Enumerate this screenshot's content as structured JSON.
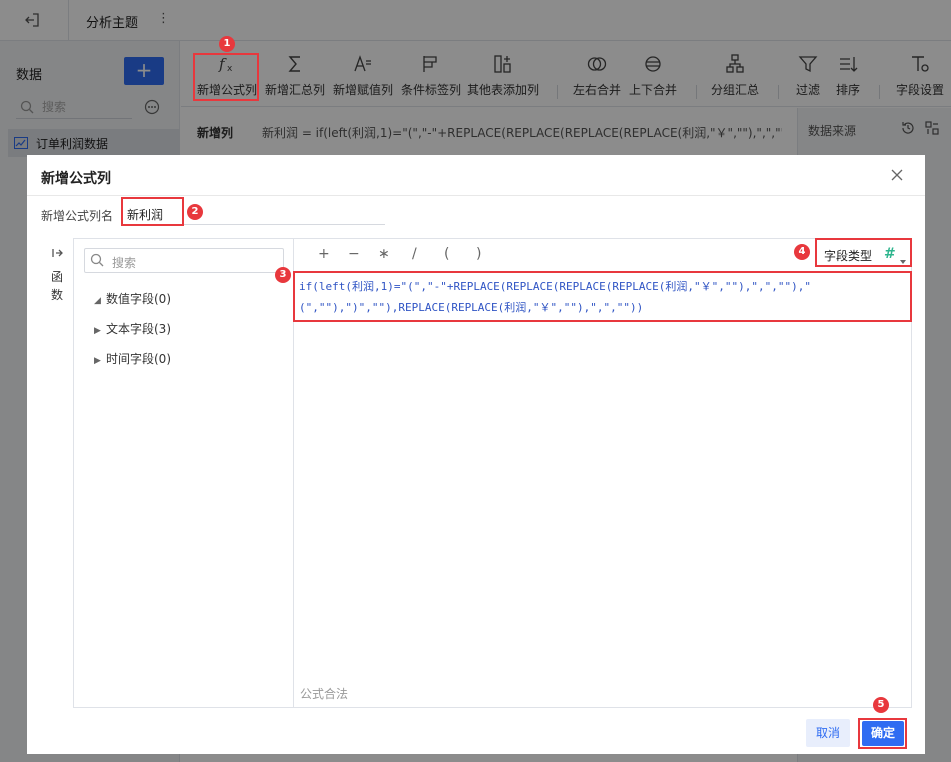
{
  "app": {
    "title": "分析主题",
    "menu_glyph": "⋮"
  },
  "sidebar": {
    "title": "数据",
    "add_label": "+",
    "search_placeholder": "搜索",
    "table_name": "订单利润数据"
  },
  "toolbar": {
    "items": [
      {
        "label": "新增公式列",
        "icon": "formula-fx-icon"
      },
      {
        "label": "新增汇总列",
        "icon": "sigma-icon"
      },
      {
        "label": "新增赋值列",
        "icon": "assign-value-icon"
      },
      {
        "label": "条件标签列",
        "icon": "flag-icon"
      },
      {
        "label": "其他表添加列",
        "icon": "add-column-icon"
      },
      {
        "label": "左右合并",
        "icon": "merge-horizontal-icon"
      },
      {
        "label": "上下合并",
        "icon": "merge-vertical-icon"
      },
      {
        "label": "分组汇总",
        "icon": "group-summary-icon"
      },
      {
        "label": "过滤",
        "icon": "filter-icon"
      },
      {
        "label": "排序",
        "icon": "sort-icon"
      },
      {
        "label": "字段设置",
        "icon": "field-settings-icon"
      }
    ]
  },
  "formula_bar": {
    "label": "新增列",
    "text": "新利润 = if(left(利润,1)=\"(\",\"-\"+REPLACE(REPLACE(REPLACE(REPLACE(利润,\"￥\",\"\"),\",\",\"\"),\"(\",\""
  },
  "right_panel": {
    "title": "数据来源"
  },
  "dialog": {
    "title": "新增公式列",
    "name_label": "新增公式列名",
    "name_value": "新利润",
    "fn_label": "函数",
    "search_placeholder": "搜索",
    "tree": [
      {
        "label": "数值字段(0)",
        "expanded": true
      },
      {
        "label": "文本字段(3)",
        "expanded": false
      },
      {
        "label": "时间字段(0)",
        "expanded": false
      }
    ],
    "operators": [
      "+",
      "−",
      "∗",
      "/",
      "(",
      ")"
    ],
    "field_type_label": "字段类型",
    "field_type_icon": "#",
    "formula": "if(left(利润,1)=\"(\",\"-\"+REPLACE(REPLACE(REPLACE(REPLACE(利润,\"￥\",\"\"),\",\",\"\"),\"(\",\"\"),\")\",\"\"),REPLACE(REPLACE(利润,\"￥\",\"\"),\",\",\"\"))",
    "validation": "公式合法",
    "cancel_label": "取消",
    "ok_label": "确定"
  },
  "annotations": {
    "color": "#e8383d",
    "badges": [
      "1",
      "2",
      "3",
      "4",
      "5"
    ]
  },
  "colors": {
    "primary": "#2f6cf2",
    "formula_text": "#2f54c4",
    "number_type": "#2fb58e"
  }
}
